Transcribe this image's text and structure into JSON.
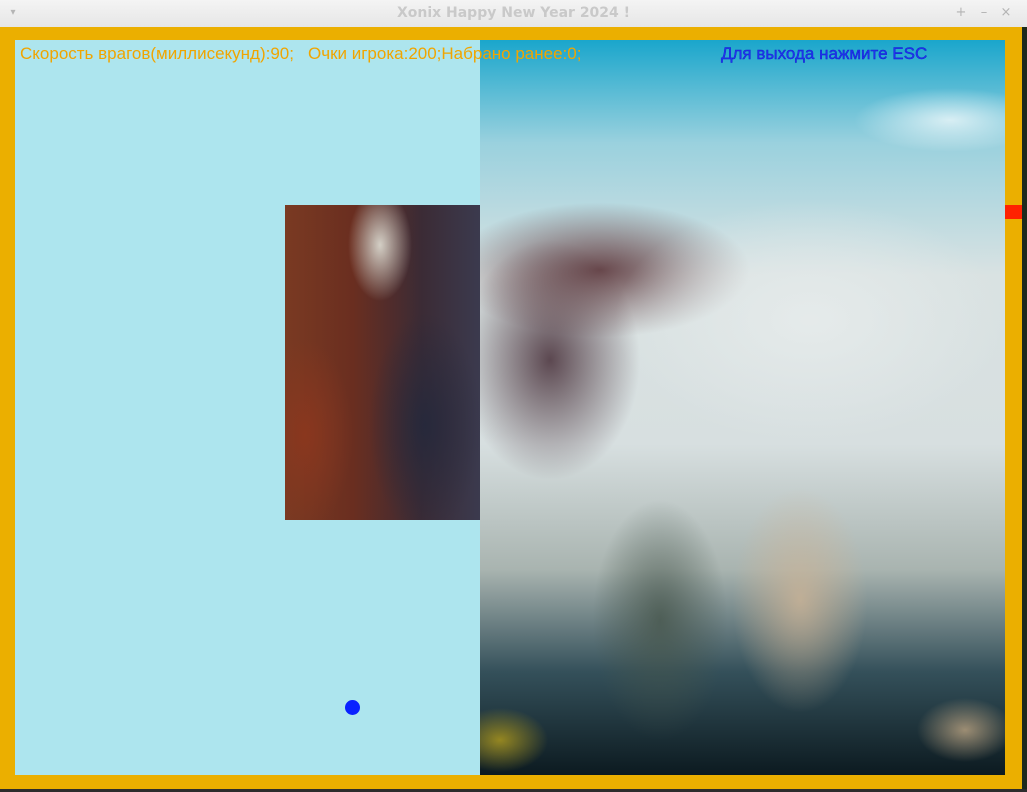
{
  "window": {
    "title": "Xonix Happy New Year 2024 !",
    "menu_icon": "chevron-down-icon",
    "buttons": [
      {
        "name": "maximize",
        "icon": "plus-icon",
        "glyph": "+"
      },
      {
        "name": "minimize",
        "icon": "minus-icon",
        "glyph": "–"
      },
      {
        "name": "close",
        "icon": "close-icon",
        "glyph": "×"
      }
    ]
  },
  "hud": {
    "enemy_speed_label": "Скорость врагов(миллисекунд):90;",
    "player_score_label": "Очки игрока:200;",
    "previous_score_label": "Набрано ранее:0;",
    "exit_hint": "Для выхода нажмите ESC"
  },
  "colors": {
    "border": "#ebaf00",
    "unclaimed_area": "#ade5ee",
    "hud_text": "#f0a500",
    "exit_hint_text": "#2233ee",
    "player": "#ff2200",
    "enemy": "#0a22ff"
  }
}
